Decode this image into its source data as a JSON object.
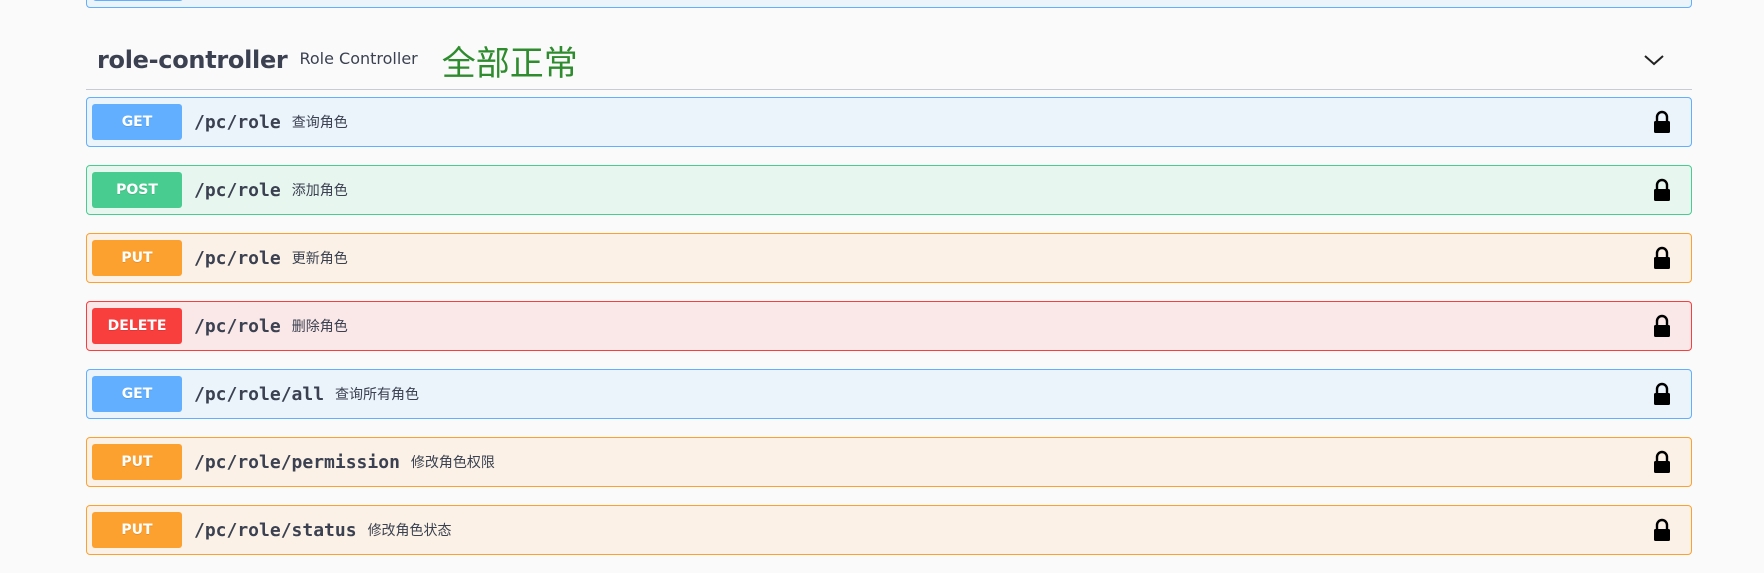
{
  "tag": {
    "name": "role-controller",
    "description": "Role Controller",
    "note": "全部正常"
  },
  "colors": {
    "get": "#61affe",
    "post": "#49cc90",
    "put": "#fca130",
    "delete": "#f93e3e",
    "note_green": "#2e8b2e"
  },
  "icons": {
    "expand": "chevron-down-icon",
    "authorize": "lock-icon"
  },
  "operations": [
    {
      "method": "GET",
      "path": "/pc/role",
      "summary": "查询角色"
    },
    {
      "method": "POST",
      "path": "/pc/role",
      "summary": "添加角色"
    },
    {
      "method": "PUT",
      "path": "/pc/role",
      "summary": "更新角色"
    },
    {
      "method": "DELETE",
      "path": "/pc/role",
      "summary": "删除角色"
    },
    {
      "method": "GET",
      "path": "/pc/role/all",
      "summary": "查询所有角色"
    },
    {
      "method": "PUT",
      "path": "/pc/role/permission",
      "summary": "修改角色权限"
    },
    {
      "method": "PUT",
      "path": "/pc/role/status",
      "summary": "修改角色状态"
    }
  ]
}
